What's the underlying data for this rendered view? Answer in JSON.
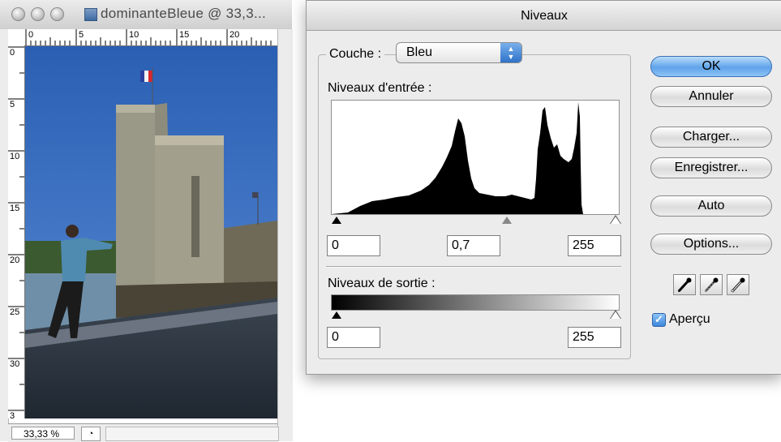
{
  "document": {
    "title": "dominanteBleue @ 33,3...",
    "ruler_h_labels": [
      "0",
      "5",
      "10",
      "15",
      "20"
    ],
    "ruler_v_labels": [
      "0",
      "5",
      "10",
      "15",
      "20",
      "25",
      "30",
      "3"
    ],
    "zoom": "33,33 %"
  },
  "dialog": {
    "title": "Niveaux",
    "channel_label": "Couche :",
    "channel_value": "Bleu",
    "input_levels_label": "Niveaux d'entrée :",
    "input_black": "0",
    "input_gamma": "0,7",
    "input_white": "255",
    "output_levels_label": "Niveaux de sortie :",
    "output_black": "0",
    "output_white": "255",
    "buttons": {
      "ok": "OK",
      "cancel": "Annuler",
      "load": "Charger...",
      "save": "Enregistrer...",
      "auto": "Auto",
      "options": "Options..."
    },
    "eyedroppers": [
      "black-eyedropper-icon",
      "gray-eyedropper-icon",
      "white-eyedropper-icon"
    ],
    "preview_label": "Aperçu",
    "preview_checked": true
  },
  "colors": {
    "accent": "#5fa3ea",
    "sky": "#2f66b8"
  }
}
